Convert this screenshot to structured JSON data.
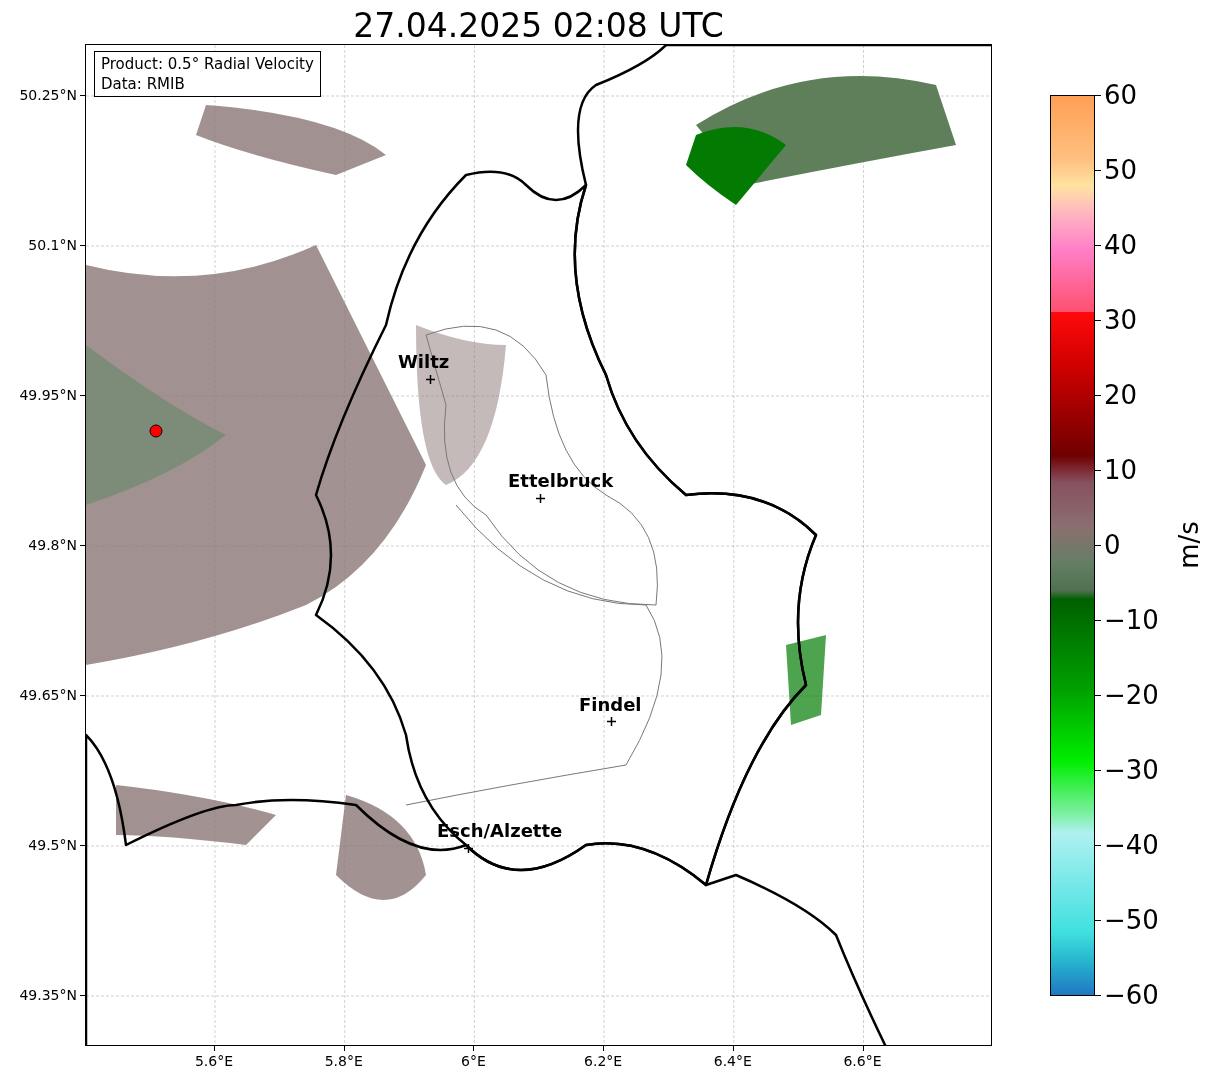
{
  "title": "27.04.2025 02:08 UTC",
  "info_box": [
    "Product: 0.5° Radial Velocity",
    "Data: RMIB"
  ],
  "y_ticks": [
    "50.25°N",
    "50.1°N",
    "49.95°N",
    "49.8°N",
    "49.65°N",
    "49.5°N",
    "49.35°N"
  ],
  "x_ticks": [
    "5.6°E",
    "5.8°E",
    "6°E",
    "6.2°E",
    "6.4°E",
    "6.6°E"
  ],
  "cities": [
    {
      "name": "Wiltz"
    },
    {
      "name": "Ettelbruck"
    },
    {
      "name": "Findel"
    },
    {
      "name": "Esch/Alzette"
    }
  ],
  "colorbar": {
    "ticks": [
      "60",
      "50",
      "40",
      "30",
      "20",
      "10",
      "0",
      "−10",
      "−20",
      "−30",
      "−40",
      "−50",
      "−60"
    ],
    "label": "m/s"
  }
}
